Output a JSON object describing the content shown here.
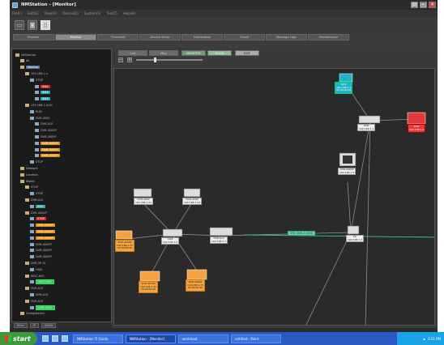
{
  "window": {
    "title": "NMStation - [Monitor]",
    "menu": [
      "File(F)",
      "Edit(E)",
      "View(V)",
      "Device(D)",
      "System(S)",
      "Tool(T)",
      "Help(H)"
    ]
  },
  "tabs": [
    {
      "label": "Register",
      "active": false
    },
    {
      "label": "Monitor",
      "active": true
    },
    {
      "label": "Threshold",
      "active": false
    },
    {
      "label": "Device Setup",
      "active": false
    },
    {
      "label": "Distribution",
      "active": false
    },
    {
      "label": "Graph",
      "active": false
    },
    {
      "label": "Message Logs",
      "active": false
    },
    {
      "label": "Maintenance",
      "active": false
    }
  ],
  "viewbar": {
    "buttons": [
      "List",
      "Map",
      "MONITOR",
      "PAUSE",
      "EXIT"
    ]
  },
  "tree": {
    "items": [
      {
        "label": "NMStation",
        "indent": 0
      },
      {
        "label": "All",
        "indent": 1
      },
      {
        "label": "Monitor",
        "indent": 1,
        "selected": true
      },
      {
        "label": "192.168.1.x",
        "indent": 2
      },
      {
        "label": "STOP",
        "indent": 3
      },
      {
        "label": "SW1",
        "indent": 4,
        "badge": "red"
      },
      {
        "label": "SW2",
        "indent": 4,
        "badge": "cyan"
      },
      {
        "label": "SW3",
        "indent": 4,
        "badge": "cyan"
      },
      {
        "label": "192.168.1.0/24",
        "indent": 2
      },
      {
        "label": "RUN",
        "indent": 3
      },
      {
        "label": "DVR-4000",
        "indent": 3
      },
      {
        "label": "DVR-A10",
        "indent": 4
      },
      {
        "label": "DVR-4000P",
        "indent": 4
      },
      {
        "label": "DVR-4000P",
        "indent": 4
      },
      {
        "label": "DVR-4000P",
        "indent": 4,
        "badge": "orange"
      },
      {
        "label": "DVR-4000P",
        "indent": 4,
        "badge": "orange"
      },
      {
        "label": "DVR-4000P",
        "indent": 4,
        "badge": "orange"
      },
      {
        "label": "STOP",
        "indent": 3
      },
      {
        "label": "Network",
        "indent": 1
      },
      {
        "label": "Location",
        "indent": 1
      },
      {
        "label": "Model",
        "indent": 1
      },
      {
        "label": "STOP",
        "indent": 2
      },
      {
        "label": "STOP",
        "indent": 3
      },
      {
        "label": "DVR-A10",
        "indent": 2
      },
      {
        "label": "SW1",
        "indent": 3,
        "badge": "cyan"
      },
      {
        "label": "DVR-4000P",
        "indent": 2
      },
      {
        "label": "STOP",
        "indent": 3,
        "badge": "red"
      },
      {
        "label": "DVR-4000P",
        "indent": 3,
        "badge": "orange"
      },
      {
        "label": "DVR-4000P",
        "indent": 3,
        "badge": "orange"
      },
      {
        "label": "DVR-4000P",
        "indent": 3,
        "badge": "orange"
      },
      {
        "label": "DVR-4000P",
        "indent": 3
      },
      {
        "label": "DVR-4000P",
        "indent": 3
      },
      {
        "label": "DVR-4000P",
        "indent": 3
      },
      {
        "label": "DVR-3P-12",
        "indent": 2
      },
      {
        "label": "HDD",
        "indent": 3
      },
      {
        "label": "WOC-640",
        "indent": 2
      },
      {
        "label": "WOC-640",
        "indent": 3,
        "badge": "green"
      },
      {
        "label": "DVR-A10",
        "indent": 2
      },
      {
        "label": "DVR-A10",
        "indent": 3
      },
      {
        "label": "DVR-A10",
        "indent": 2
      },
      {
        "label": "DVR-4000",
        "indent": 3,
        "badge": "green"
      },
      {
        "label": "Unregistered",
        "indent": 1
      }
    ]
  },
  "tree_footer": [
    "View",
    "IP",
    "UNKN"
  ],
  "map": {
    "link_label": "192.168.1.0/24",
    "nodes": [
      {
        "id": "sw-top",
        "label": "SW1\n192.168.1.3\n00:00:00:00",
        "style": "cyan"
      },
      {
        "id": "dvr-right",
        "label": "DVR\n192.168.1.1\n",
        "style": "plain"
      },
      {
        "id": "red-node",
        "label": "DVR\n192.168.1.5\n",
        "style": "red"
      },
      {
        "id": "monitor",
        "label": "DVR-4000P\n192.168.1.9",
        "style": "plain"
      },
      {
        "id": "pc",
        "label": "PC\n192.168.1.6",
        "style": "plain"
      },
      {
        "id": "dvr-a",
        "label": "DVR-4000\n192.168.1.21",
        "style": "plain"
      },
      {
        "id": "dvr-b",
        "label": "DVR-4000\n192.168.1.22",
        "style": "plain"
      },
      {
        "id": "switch-mid",
        "label": "SW2\n192.168.1.2",
        "style": "plain"
      },
      {
        "id": "dvr-c",
        "label": "DVR-A10\n192.168.1.7",
        "style": "plain"
      },
      {
        "id": "orange-left",
        "label": "DVR-4000P\n192.168.1.31\n00:00:00:00",
        "style": "orange"
      },
      {
        "id": "orange-b1",
        "label": "DVR-4000P\n192.168.1.32\n00:00:00:00",
        "style": "orange"
      },
      {
        "id": "orange-b2",
        "label": "DVR-4000P\n192.168.1.33\n00:00:00:00",
        "style": "orange"
      }
    ]
  },
  "taskbar": {
    "start": "start",
    "tasks": [
      "NMStation Ti Guide",
      "NMStation - [Monitor]",
      "workload",
      "untitled - Paint"
    ],
    "clock": "1:21 PM"
  }
}
